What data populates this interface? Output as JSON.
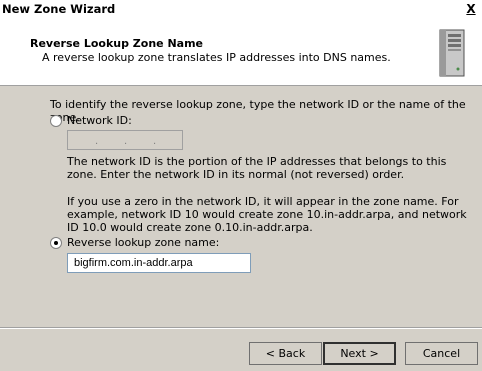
{
  "window": {
    "title": "New Zone Wizard",
    "close_glyph": "X"
  },
  "header": {
    "title": "Reverse Lookup Zone Name",
    "subtitle": "A reverse lookup zone translates IP addresses into DNS names.",
    "icon": "server-icon"
  },
  "content": {
    "intro": "To identify the reverse lookup zone, type the network ID or the name of the zone.",
    "network_id_option": {
      "label": "Network ID:",
      "selected": false,
      "octet_separator": "."
    },
    "network_id_help": "The network ID is the portion of the IP addresses that belongs to this zone. Enter the network ID in its normal (not reversed) order.",
    "network_id_example": "If you use a zero in the network ID, it will appear in the zone name. For example, network ID 10 would create zone 10.in-addr.arpa, and network ID 10.0 would create zone 0.10.in-addr.arpa.",
    "zone_name_option": {
      "label": "Reverse lookup zone name:",
      "selected": true,
      "value": "bigfirm.com.in-addr.arpa"
    }
  },
  "buttons": {
    "back": "< Back",
    "next": "Next >",
    "cancel": "Cancel"
  }
}
